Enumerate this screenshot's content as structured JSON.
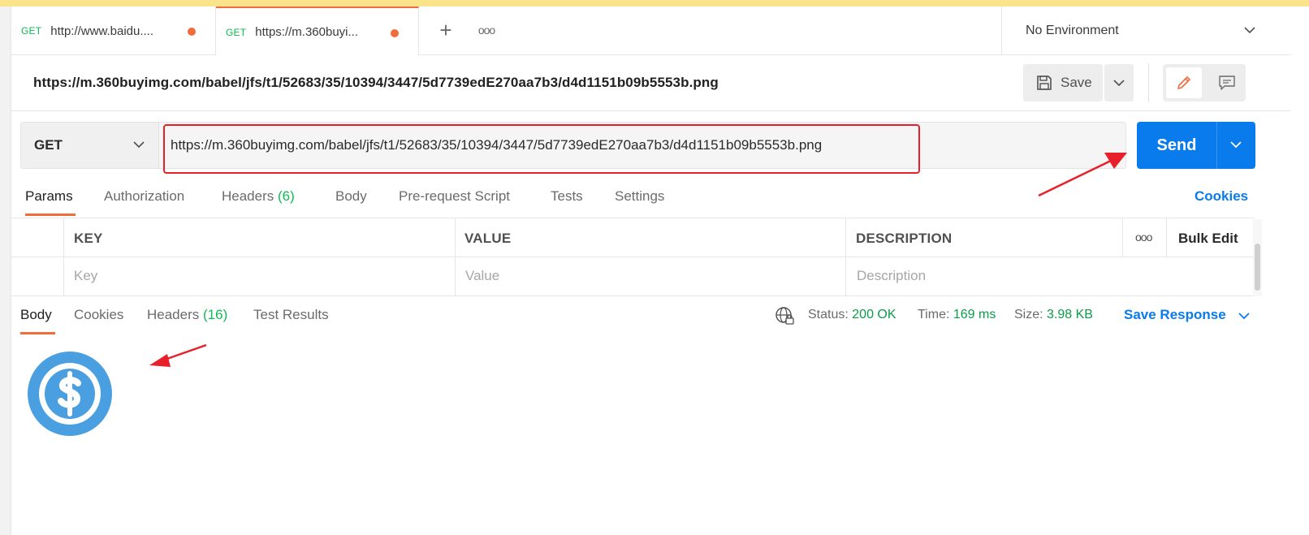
{
  "tabs": [
    {
      "method": "GET",
      "label": "http://www.baidu....",
      "unsaved": true,
      "active": false
    },
    {
      "method": "GET",
      "label": "https://m.360buyi...",
      "unsaved": true,
      "active": true
    }
  ],
  "tabs_more": "ooo",
  "environment": {
    "selected": "No Environment"
  },
  "request": {
    "title": "https://m.360buyimg.com/babel/jfs/t1/52683/35/10394/3447/5d7739edE270aa7b3/d4d1151b09b5553b.png",
    "method": "GET",
    "url": "https://m.360buyimg.com/babel/jfs/t1/52683/35/10394/3447/5d7739edE270aa7b3/d4d1151b09b5553b.png"
  },
  "toolbar": {
    "save_label": "Save",
    "send_label": "Send"
  },
  "request_tabs": {
    "params": "Params",
    "authorization": "Authorization",
    "headers": "Headers",
    "headers_count": "(6)",
    "body": "Body",
    "prerequest": "Pre-request Script",
    "tests": "Tests",
    "settings": "Settings",
    "cookies": "Cookies"
  },
  "params_table": {
    "columns": [
      "KEY",
      "VALUE",
      "DESCRIPTION"
    ],
    "more": "ooo",
    "bulk_edit": "Bulk Edit",
    "placeholders": {
      "key": "Key",
      "value": "Value",
      "description": "Description"
    }
  },
  "response": {
    "tabs": {
      "body": "Body",
      "cookies": "Cookies",
      "headers": "Headers",
      "headers_count": "(16)",
      "test_results": "Test Results"
    },
    "status_label": "Status:",
    "status_value": "200 OK",
    "time_label": "Time:",
    "time_value": "169 ms",
    "size_label": "Size:",
    "size_value": "3.98 KB",
    "save_response": "Save Response",
    "image_icon": "dollar-coin-icon"
  },
  "colors": {
    "accent": "#f26b3a",
    "send_blue": "#097bed",
    "success_green": "#0cbb52",
    "annotation_red": "#e8202a",
    "top_banner": "#fbe38c",
    "coin_blue": "#4a9fe0"
  }
}
